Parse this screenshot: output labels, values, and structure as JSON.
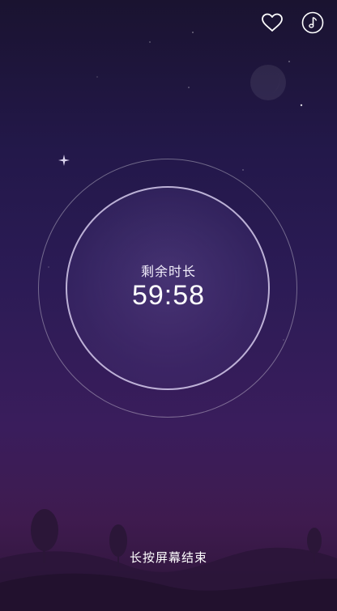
{
  "header": {
    "favorite_icon": "heart-outline-icon",
    "music_icon": "music-note-circle-icon"
  },
  "timer": {
    "label": "剩余时长",
    "remaining": "59:58"
  },
  "footer": {
    "hint": "长按屏幕结束"
  },
  "colors": {
    "background_top": "#1a1330",
    "background_bottom": "#3f1b4f",
    "hills": "#2a1538"
  }
}
